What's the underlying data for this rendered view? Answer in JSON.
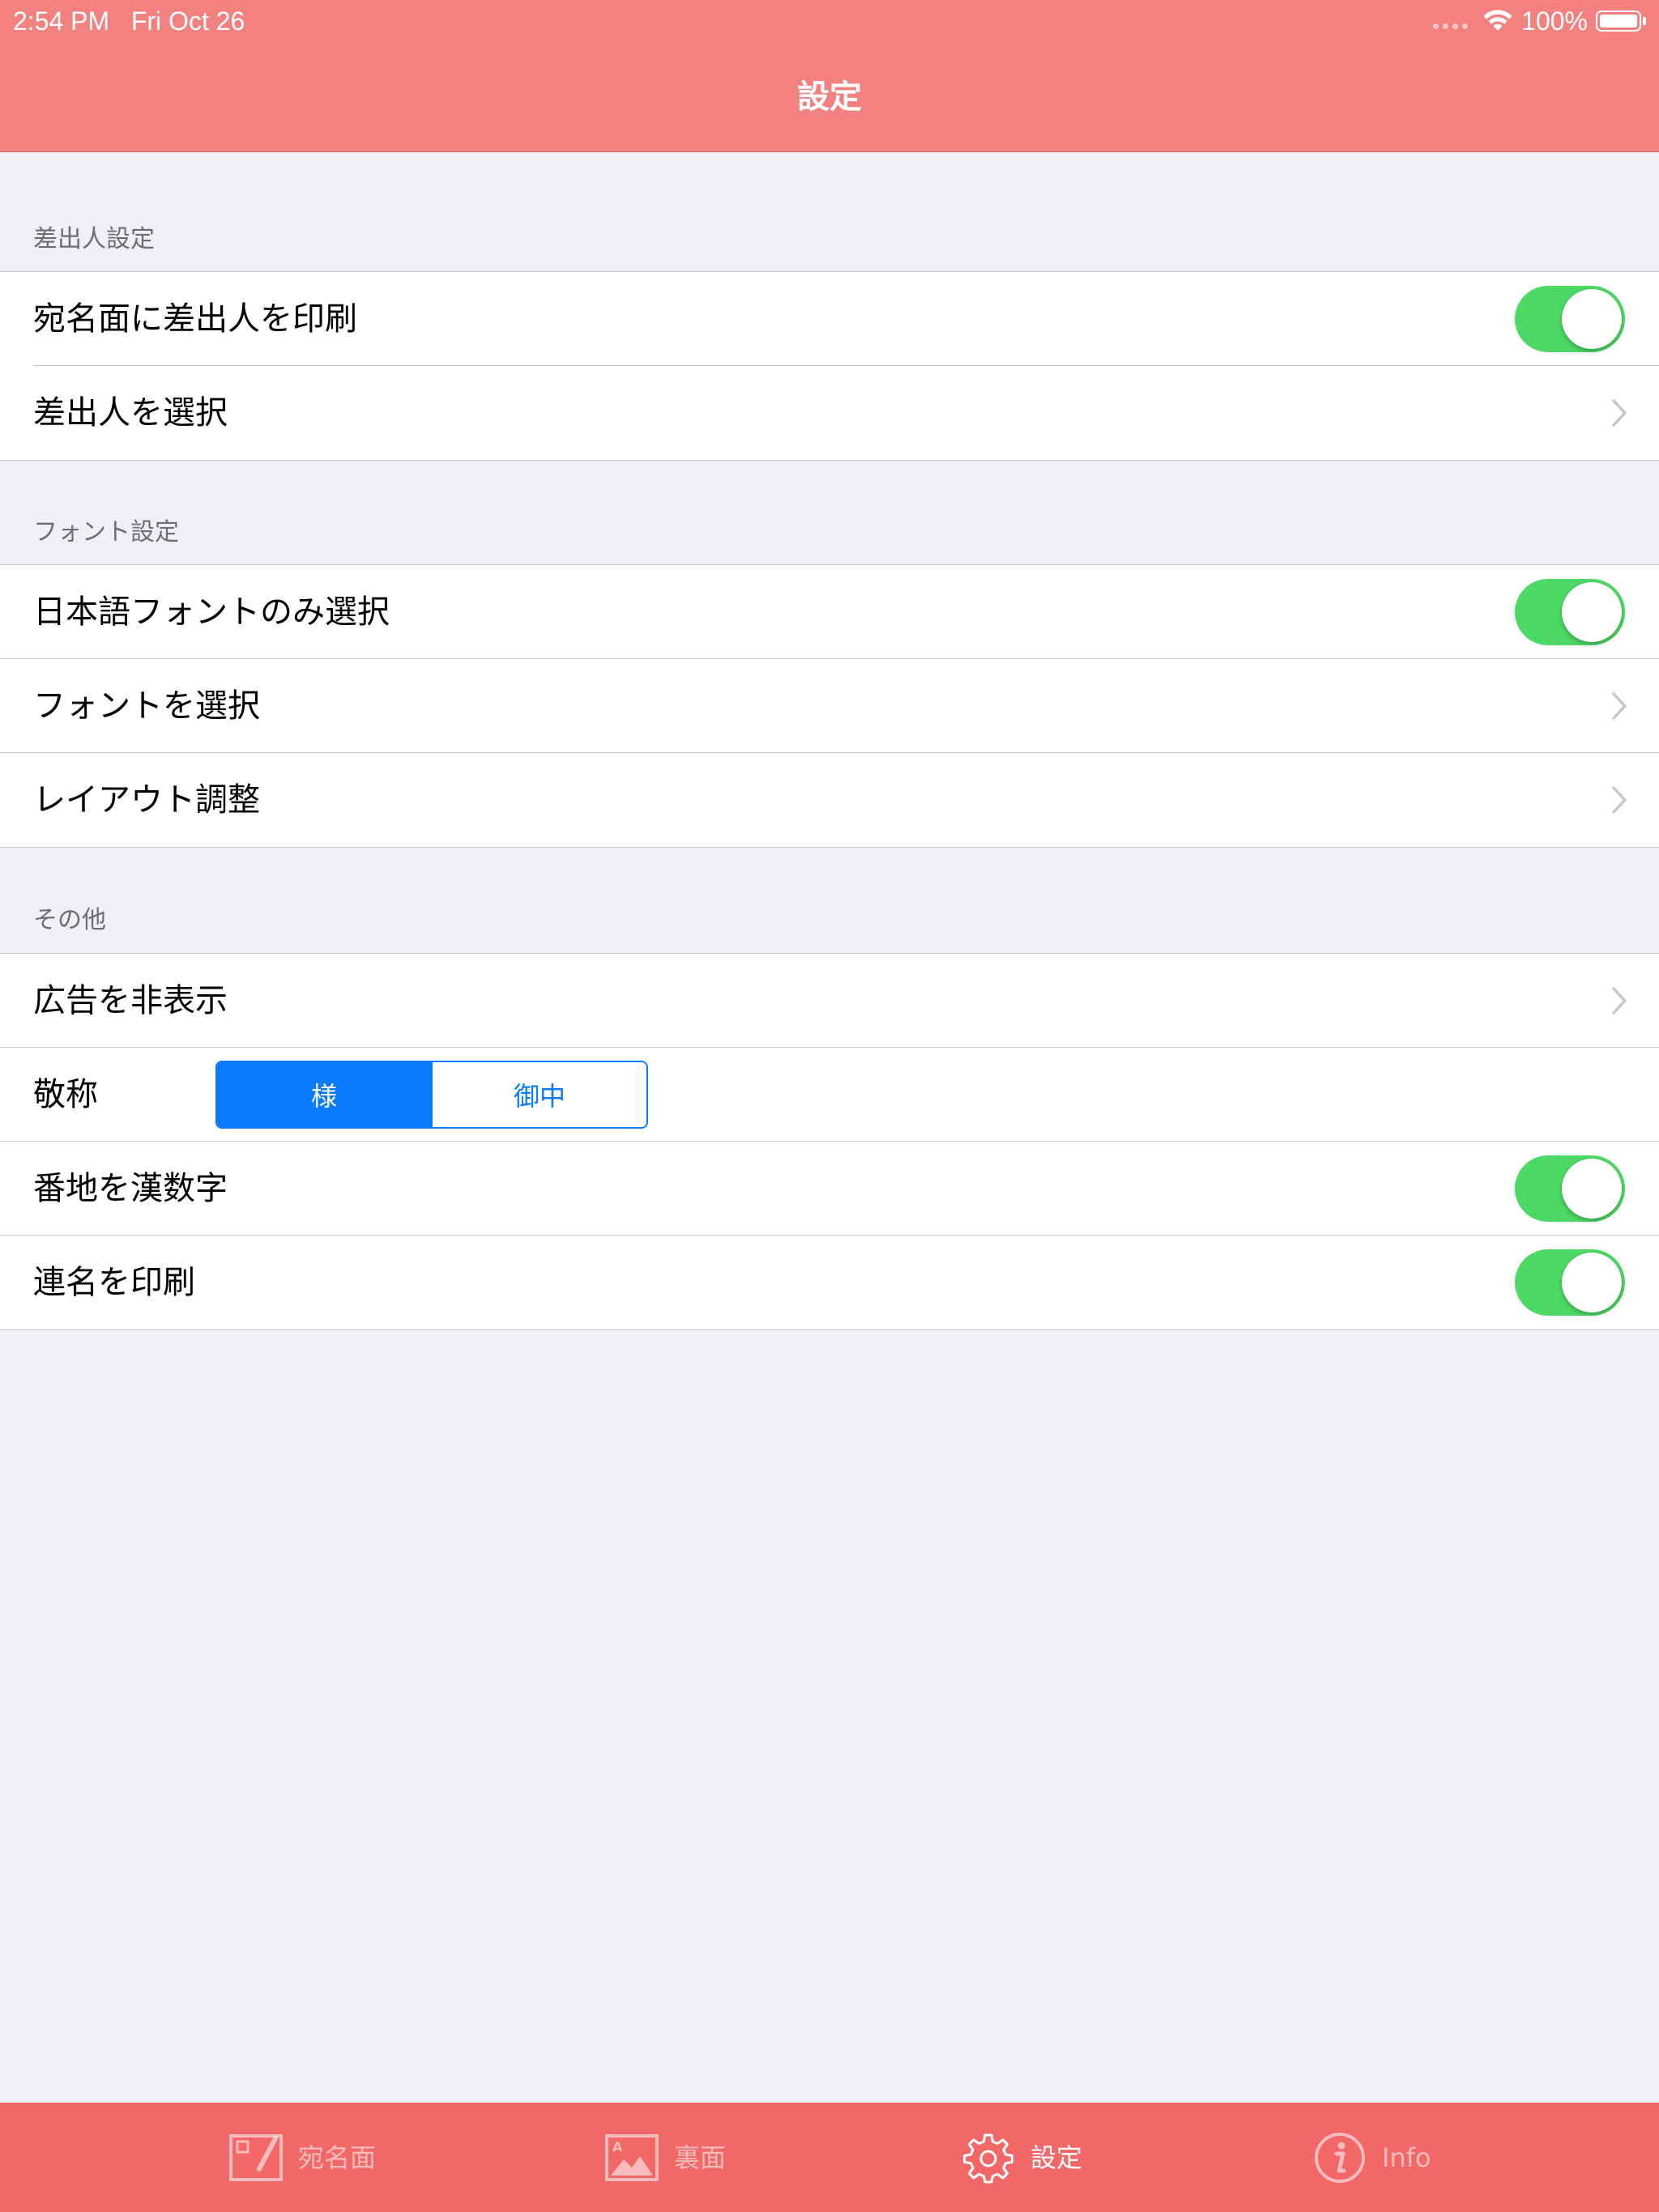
{
  "status_bar": {
    "time": "2:54 PM",
    "date": "Fri Oct 26",
    "battery_percent": "100%",
    "battery_level": 1.0
  },
  "nav": {
    "title": "設定"
  },
  "sections": {
    "sender": {
      "header": "差出人設定",
      "print_sender": {
        "label": "宛名面に差出人を印刷",
        "on": true
      },
      "choose_sender": {
        "label": "差出人を選択"
      }
    },
    "font": {
      "header": "フォント設定",
      "japanese_only": {
        "label": "日本語フォントのみ選択",
        "on": true
      },
      "choose_font": {
        "label": "フォントを選択"
      },
      "layout": {
        "label": "レイアウト調整"
      }
    },
    "other": {
      "header": "その他",
      "hide_ads": {
        "label": "広告を非表示"
      },
      "honorific": {
        "label": "敬称",
        "options": [
          "様",
          "御中"
        ],
        "selected": "様"
      },
      "kanji_numbers": {
        "label": "番地を漢数字",
        "on": true
      },
      "joint_names": {
        "label": "連名を印刷",
        "on": true
      }
    }
  },
  "tabs": [
    {
      "label": "宛名面",
      "icon": "address-side-icon",
      "active": false
    },
    {
      "label": "裏面",
      "icon": "image-icon",
      "active": false
    },
    {
      "label": "設定",
      "icon": "gear-icon",
      "active": true
    },
    {
      "label": "Info",
      "icon": "info-icon",
      "active": false
    }
  ],
  "colors": {
    "nav_bar": "#F28180",
    "tab_bar": "#F26868",
    "switch_on": "#4CD964",
    "segment_tint": "#0A7AFF",
    "background": "#EFEFF4"
  }
}
